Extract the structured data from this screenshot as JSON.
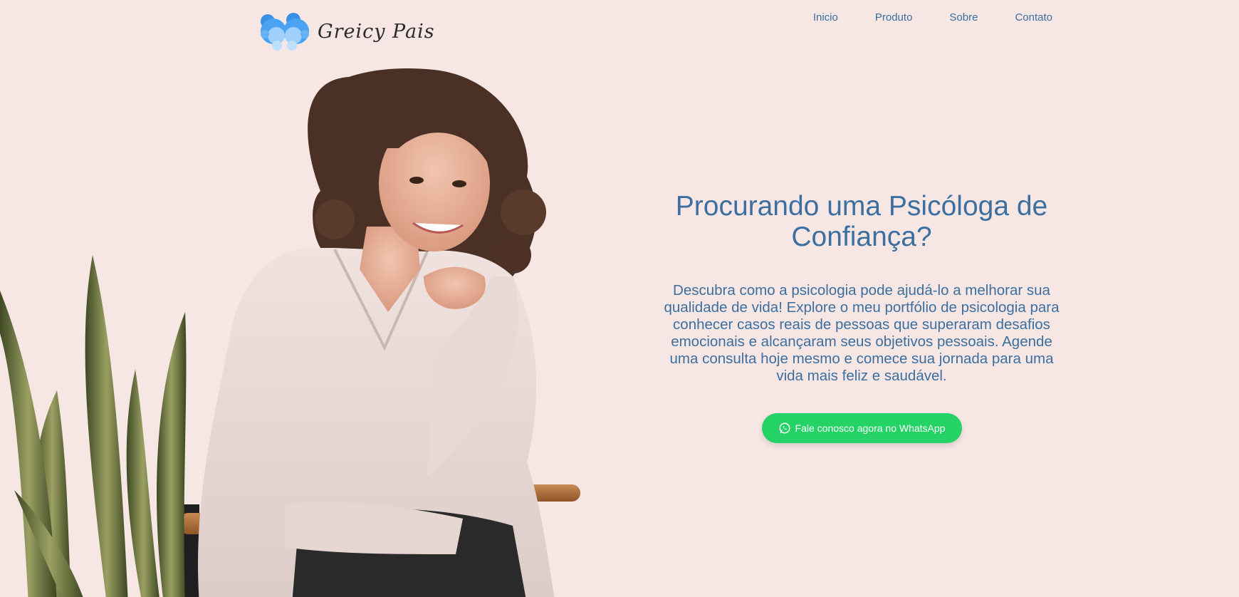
{
  "header": {
    "logo_text": "Greicy Pais",
    "nav": [
      {
        "label": "Inicio"
      },
      {
        "label": "Produto"
      },
      {
        "label": "Sobre"
      },
      {
        "label": "Contato"
      }
    ]
  },
  "hero": {
    "title": "Procurando uma Psicóloga de Confiança?",
    "description": "Descubra como a psicologia pode ajudá-lo a melhorar sua qualidade de vida! Explore o meu portfólio de psicologia para conhecer casos reais de pessoas que superaram desafios emocionais e alcançaram seus objetivos pessoais. Agende uma consulta hoje mesmo e comece sua jornada para uma vida mais feliz e saudável.",
    "cta_label": "Fale conosco agora no WhatsApp",
    "cta_icon": "whatsapp-icon"
  },
  "colors": {
    "background": "#f6e7e5",
    "accent_text": "#3c6f9f",
    "cta_green": "#25d266",
    "logo_blue": "#4aa3f0"
  }
}
